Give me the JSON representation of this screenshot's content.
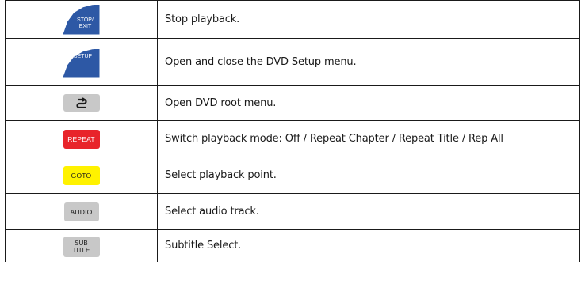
{
  "rows": [
    {
      "key_label_line1": "STOP/",
      "key_label_line2": "EXIT",
      "key_color": "#2d58a5",
      "description": "Stop playback."
    },
    {
      "key_label": "SETUP",
      "key_color": "#2d58a5",
      "description": "Open and close the DVD Setup menu."
    },
    {
      "key_icon": "root-menu-icon",
      "key_color": "#c8c8c8",
      "description": "Open DVD root menu."
    },
    {
      "key_label": "REPEAT",
      "key_color": "#e8242a",
      "description": "Switch playback mode: Off / Repeat Chapter / Repeat Title / Rep All"
    },
    {
      "key_label": "GOTO",
      "key_color": "#fff200",
      "description": "Select playback point."
    },
    {
      "key_label": "AUDIO",
      "key_color": "#c8c8c8",
      "description": "Select audio track."
    },
    {
      "key_label_line1": "SUB",
      "key_label_line2": "TITLE",
      "key_color": "#c8c8c8",
      "description": "Subtitle Select."
    }
  ]
}
